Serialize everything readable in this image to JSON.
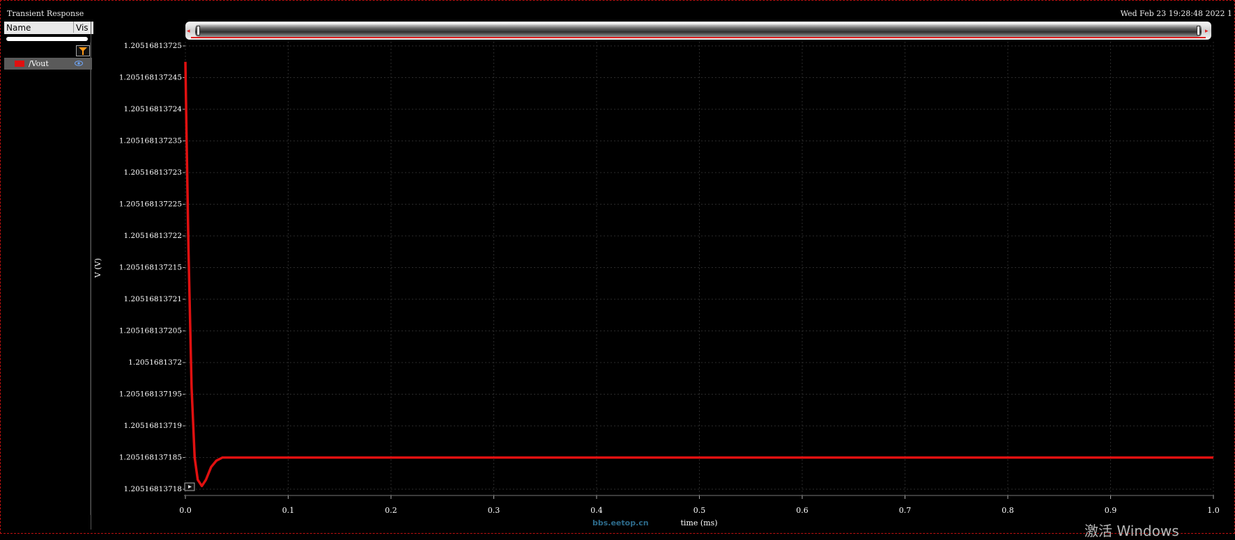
{
  "window": {
    "title": "Transient Response",
    "datetime": "Wed Feb 23 19:28:48 2022  1"
  },
  "sidebar": {
    "col_name": "Name",
    "col_vis": "Vis",
    "signals": [
      {
        "label": "/Vout",
        "color": "#e01010"
      }
    ]
  },
  "watermarks": {
    "forum": "bbs.eetop.cn",
    "activation": "激活 Windows"
  },
  "chart_data": {
    "type": "line",
    "title": "",
    "xlabel": "time (ms)",
    "ylabel": "V (V)",
    "xlim": [
      0,
      1.0
    ],
    "ylim": [
      1.20516813718,
      1.20516813725
    ],
    "x_ticks": [
      "0.0",
      "0.1",
      "0.2",
      "0.3",
      "0.4",
      "0.5",
      "0.6",
      "0.7",
      "0.8",
      "0.9",
      "1.0"
    ],
    "y_ticks": [
      "1.20516813718",
      "1.205168137185",
      "1.20516813719",
      "1.205168137195",
      "1.2051681372",
      "1.205168137205",
      "1.20516813721",
      "1.205168137215",
      "1.20516813722",
      "1.205168137225",
      "1.20516813723",
      "1.205168137235",
      "1.20516813724",
      "1.205168137245",
      "1.20516813725"
    ],
    "grid": true,
    "series": [
      {
        "name": "/Vout",
        "color": "#e01010",
        "x": [
          0.0,
          0.001,
          0.003,
          0.006,
          0.009,
          0.012,
          0.016,
          0.02,
          0.025,
          0.03,
          0.036,
          0.042,
          0.05,
          0.1,
          0.2,
          0.3,
          0.33,
          0.4,
          0.5,
          0.6,
          0.7,
          0.8,
          0.9,
          0.98,
          1.0
        ],
        "y": [
          1.2051681372475,
          1.205168137237,
          1.205168137218,
          1.205168137196,
          1.205168137185,
          1.2051681371815,
          1.2051681371805,
          1.2051681371815,
          1.2051681371835,
          1.2051681371845,
          1.205168137185,
          1.205168137185,
          1.205168137185,
          1.205168137185,
          1.205168137185,
          1.205168137185,
          1.205168137185,
          1.205168137185,
          1.205168137185,
          1.205168137185,
          1.205168137185,
          1.205168137185,
          1.205168137185,
          1.205168137185,
          1.205168137185
        ]
      }
    ]
  }
}
